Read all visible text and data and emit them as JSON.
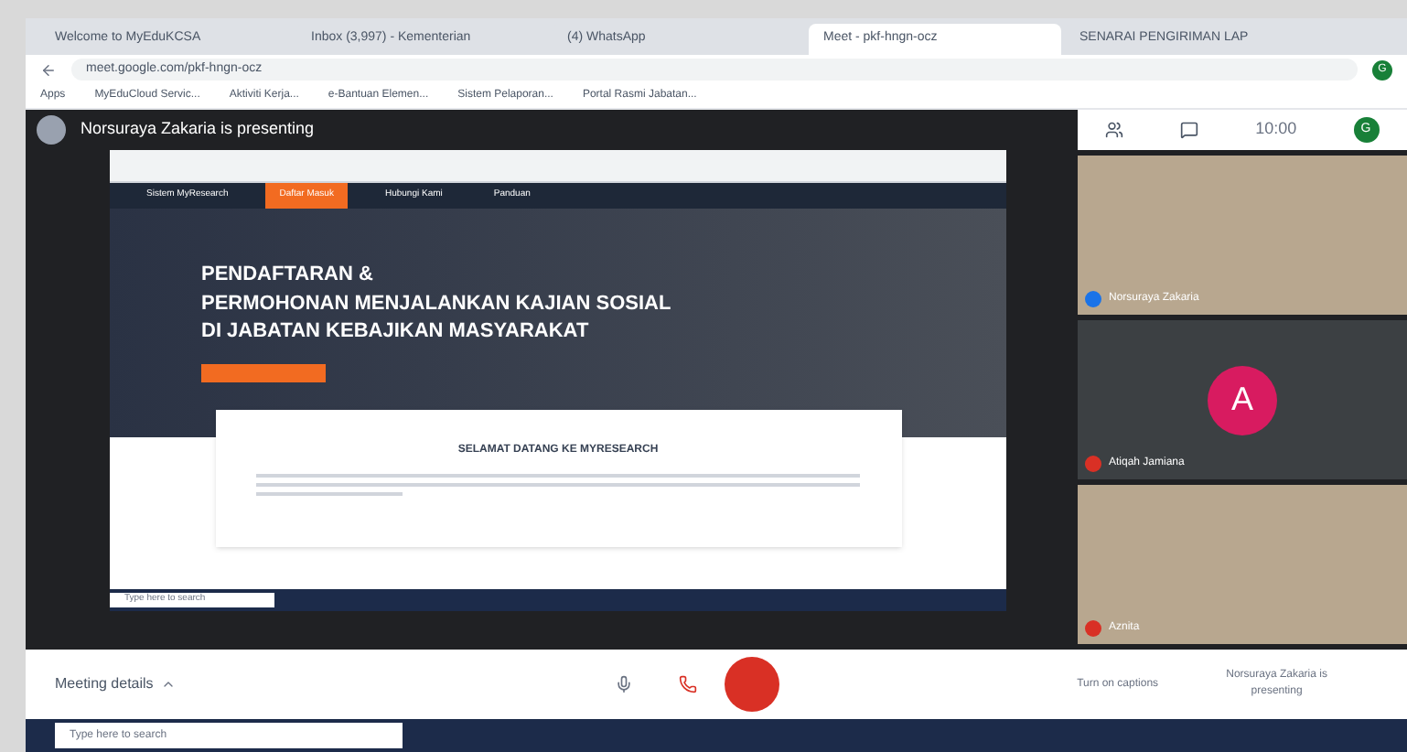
{
  "browser": {
    "tabs": [
      {
        "label": "Welcome to MyEduKCSA",
        "selected": false
      },
      {
        "label": "Inbox (3,997) - Kementerian",
        "selected": false
      },
      {
        "label": "(4) WhatsApp",
        "selected": false
      },
      {
        "label": "Meet - pkf-hngn-ocz",
        "selected": true
      },
      {
        "label": "SENARAI PENGIRIMAN LAP",
        "selected": false
      }
    ],
    "url": "meet.google.com/pkf-hngn-ocz",
    "account_initial": "G",
    "bookmarks": [
      "Apps",
      "MyEduCloud Servic...",
      "Aktiviti Kerja...",
      "e-Bantuan Elemen...",
      "Sistem Pelaporan...",
      "Portal Rasmi Jabatan..."
    ]
  },
  "meet": {
    "presenting": "Norsuraya Zakaria is presenting",
    "time": "10:00",
    "you_initial": "G",
    "shared_screen": {
      "nav": [
        {
          "label": "Sistem MyResearch",
          "selected": false
        },
        {
          "label": "Daftar Masuk",
          "selected": true
        },
        {
          "label": "Hubungi Kami",
          "selected": false
        },
        {
          "label": "Panduan",
          "selected": false
        }
      ],
      "title_lines": [
        "PENDAFTARAN &",
        "PERMOHONAN MENJALANKAN KAJIAN SOSIAL",
        "DI JABATAN KEBAJIKAN MASYARAKAT"
      ],
      "modal_title": "SELAMAT DATANG KE MYRESEARCH",
      "taskbar_search": "Type here to search"
    },
    "participants": [
      {
        "kind": "video",
        "name": "Norsuraya Zakaria",
        "muted": false
      },
      {
        "kind": "avatar",
        "initial": "A",
        "name": "Atiqah Jamiana",
        "muted": true
      },
      {
        "kind": "video",
        "name": "Aznita",
        "muted": true
      }
    ],
    "controls": {
      "details": "Meeting details",
      "captions": "Turn on captions",
      "presenting": "Norsuraya Zakaria is presenting",
      "camera_off": true
    }
  },
  "taskbar": {
    "search": "Type here to search"
  }
}
